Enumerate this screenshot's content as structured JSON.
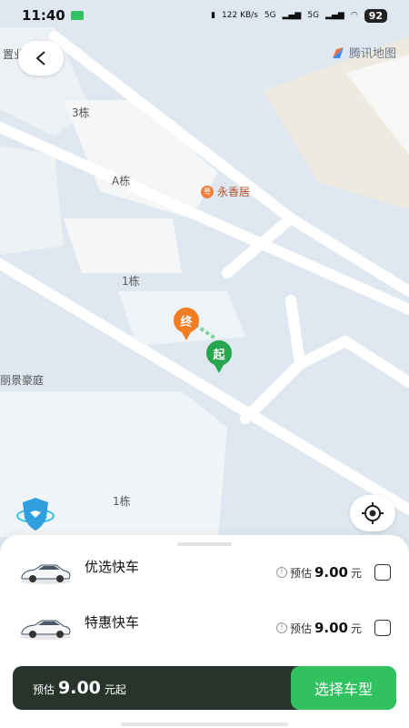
{
  "status_bar": {
    "time": "11:40",
    "network_speed": "122 KB/s",
    "signal_1": "5G",
    "signal_2": "5G",
    "battery": "92"
  },
  "map": {
    "brand": "腾讯地图",
    "labels": {
      "top_left": "置业",
      "building_3": "3栋",
      "building_a": "A栋",
      "building_1_upper": "1栋",
      "estate": "丽景豪庭",
      "building_1_lower": "1栋"
    },
    "poi": {
      "name": "永香居",
      "icon_text": "粤"
    },
    "end_pin": "终",
    "start_pin": "起"
  },
  "options": [
    {
      "name": "优选快车",
      "est_label": "预估",
      "price": "9.00",
      "unit": "元",
      "selected": false
    },
    {
      "name": "特惠快车",
      "est_label": "预估",
      "price": "9.00",
      "unit": "元",
      "selected": false
    }
  ],
  "footer": {
    "est_label": "预估",
    "price": "9.00",
    "suffix": "元起",
    "button": "选择车型"
  },
  "colors": {
    "accent_green": "#31c160",
    "bar_dark": "#27332b",
    "end_orange": "#f07d21",
    "start_green": "#27a650"
  }
}
